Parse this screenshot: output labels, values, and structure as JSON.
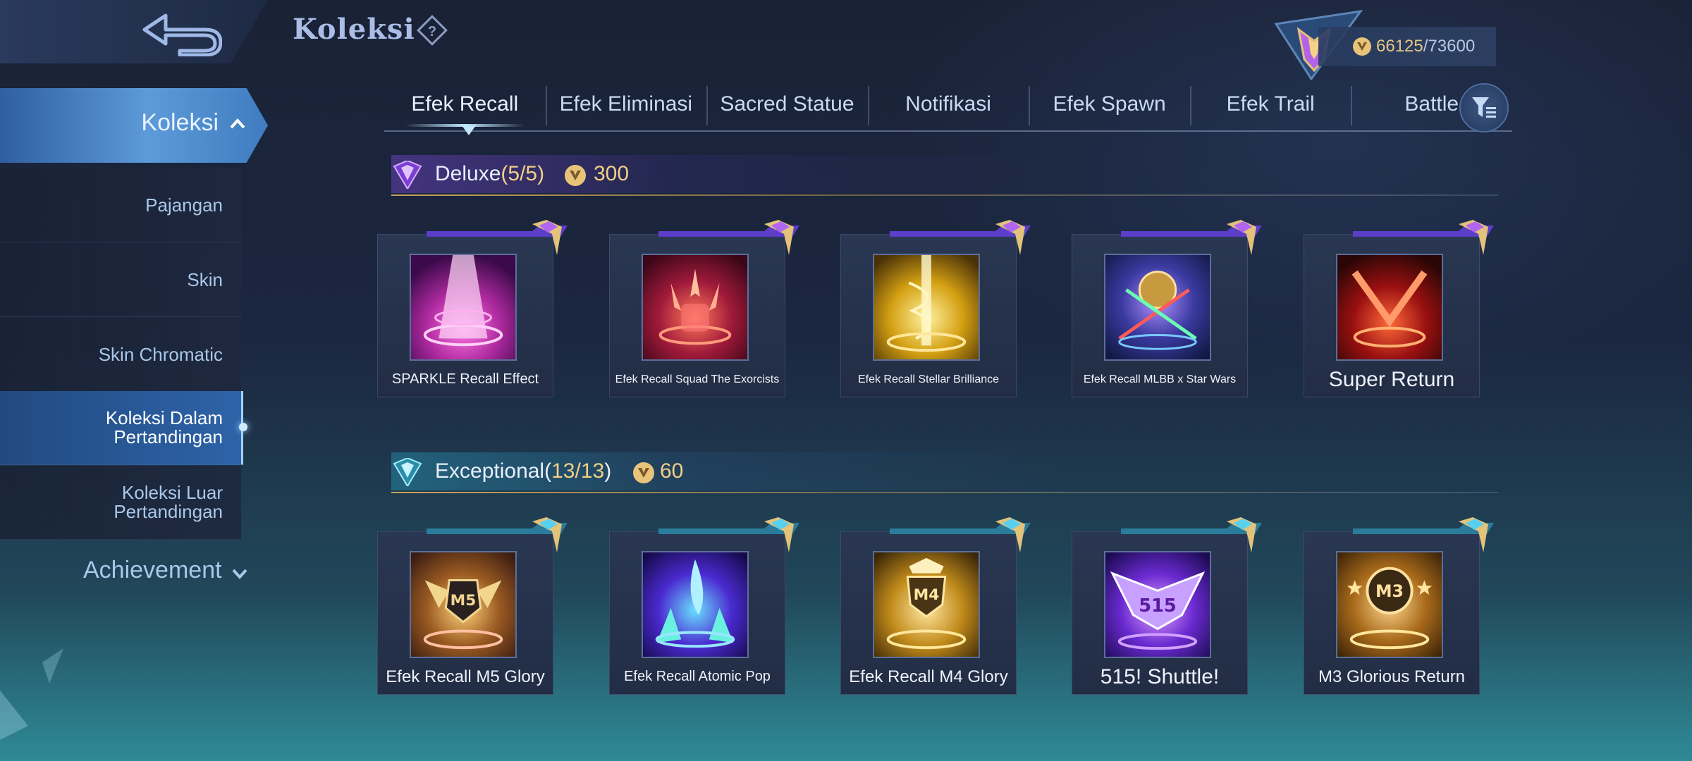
{
  "header": {
    "title": "Koleksi"
  },
  "currency": {
    "current": "66125",
    "separator": "/",
    "max": "73600"
  },
  "sidebar": {
    "active_group": "Koleksi",
    "items": [
      {
        "label": "Pajangan"
      },
      {
        "label": "Skin"
      },
      {
        "label": "Skin Chromatic"
      },
      {
        "label": "Koleksi Dalam Pertandingan",
        "selected": true
      },
      {
        "label": "Koleksi Luar Pertandingan"
      }
    ],
    "achievement": "Achievement"
  },
  "tabs": [
    "Efek Recall",
    "Efek Eliminasi",
    "Sacred Statue",
    "Notifikasi",
    "Efek Spawn",
    "Efek Trail",
    "Battle"
  ],
  "sections": {
    "deluxe": {
      "name": "Deluxe",
      "count": "(5/5)",
      "price": "300"
    },
    "exceptional": {
      "name": "Exceptional",
      "count_open": "(",
      "count": "13/13",
      "count_close": ")",
      "price": "60"
    }
  },
  "deluxe_items": [
    {
      "name": "SPARKLE Recall Effect"
    },
    {
      "name": "Efek Recall Squad The Exorcists"
    },
    {
      "name": "Efek Recall Stellar Brilliance"
    },
    {
      "name": "Efek Recall MLBB x Star Wars"
    },
    {
      "name": "Super Return"
    }
  ],
  "exceptional_items": [
    {
      "name": "Efek Recall M5 Glory",
      "emblem": "M5"
    },
    {
      "name": "Efek Recall Atomic Pop"
    },
    {
      "name": "Efek Recall M4 Glory",
      "emblem": "M4"
    },
    {
      "name": "515! Shuttle!",
      "emblem": "515"
    },
    {
      "name": "M3 Glorious Return",
      "emblem": "M3"
    }
  ],
  "colors": {
    "accent_gold": "#f0cf85",
    "deluxe_purple": "#8a4fe0",
    "exceptional_teal": "#3fb4c9"
  }
}
